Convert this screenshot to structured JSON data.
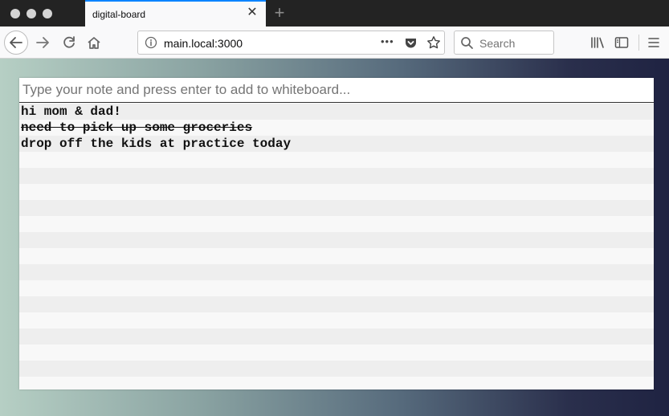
{
  "browser": {
    "tab_title": "digital-board",
    "tab_close": "✕",
    "new_tab": "+",
    "url": "main.local:3000",
    "page_actions": "•••",
    "search_placeholder": "Search"
  },
  "board": {
    "input_placeholder": "Type your note and press enter to add to whiteboard...",
    "notes": [
      {
        "text": "hi mom & dad!",
        "done": false
      },
      {
        "text": "need to pick up some groceries",
        "done": true
      },
      {
        "text": "drop off the kids at practice today",
        "done": false
      }
    ],
    "colors": {
      "gradient": [
        "#b6cfc4",
        "#566a7c",
        "#1f2342"
      ],
      "row_alt": "#eeeeee",
      "row_base": "#f8f8f8"
    }
  }
}
